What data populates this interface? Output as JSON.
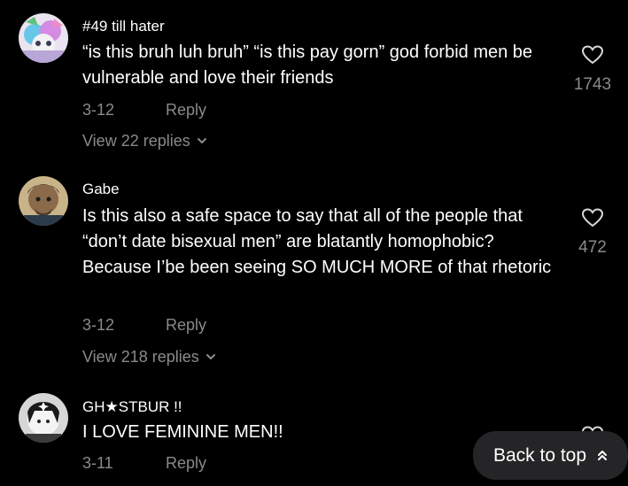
{
  "comments": [
    {
      "username": "#49 till hater",
      "text": "“is this bruh luh bruh” “is this pay gorn” god forbid men be vulnerable and love their friends",
      "date": "3-12",
      "reply_label": "Reply",
      "likes": "1743",
      "view_replies": "View 22 replies"
    },
    {
      "username": "Gabe",
      "text": "Is this also a safe space to say that all of the people that “don’t date bisexual men” are blatantly homophobic? Because I’be been seeing SO MUCH MORE of that rhetoric",
      "date": "3-12",
      "reply_label": "Reply",
      "likes": "472",
      "view_replies": "View 218 replies"
    },
    {
      "username": "GH★STBUR !!",
      "text": "I LOVE FEMININE MEN!!",
      "date": "3-11",
      "reply_label": "Reply"
    }
  ],
  "back_to_top": {
    "label": "Back to top",
    "icon": "double-chevron-up-icon"
  },
  "colors": {
    "background": "#000000",
    "primary_text": "#ffffff",
    "secondary_text": "#8a8a8e",
    "button_bg": "#252527"
  }
}
